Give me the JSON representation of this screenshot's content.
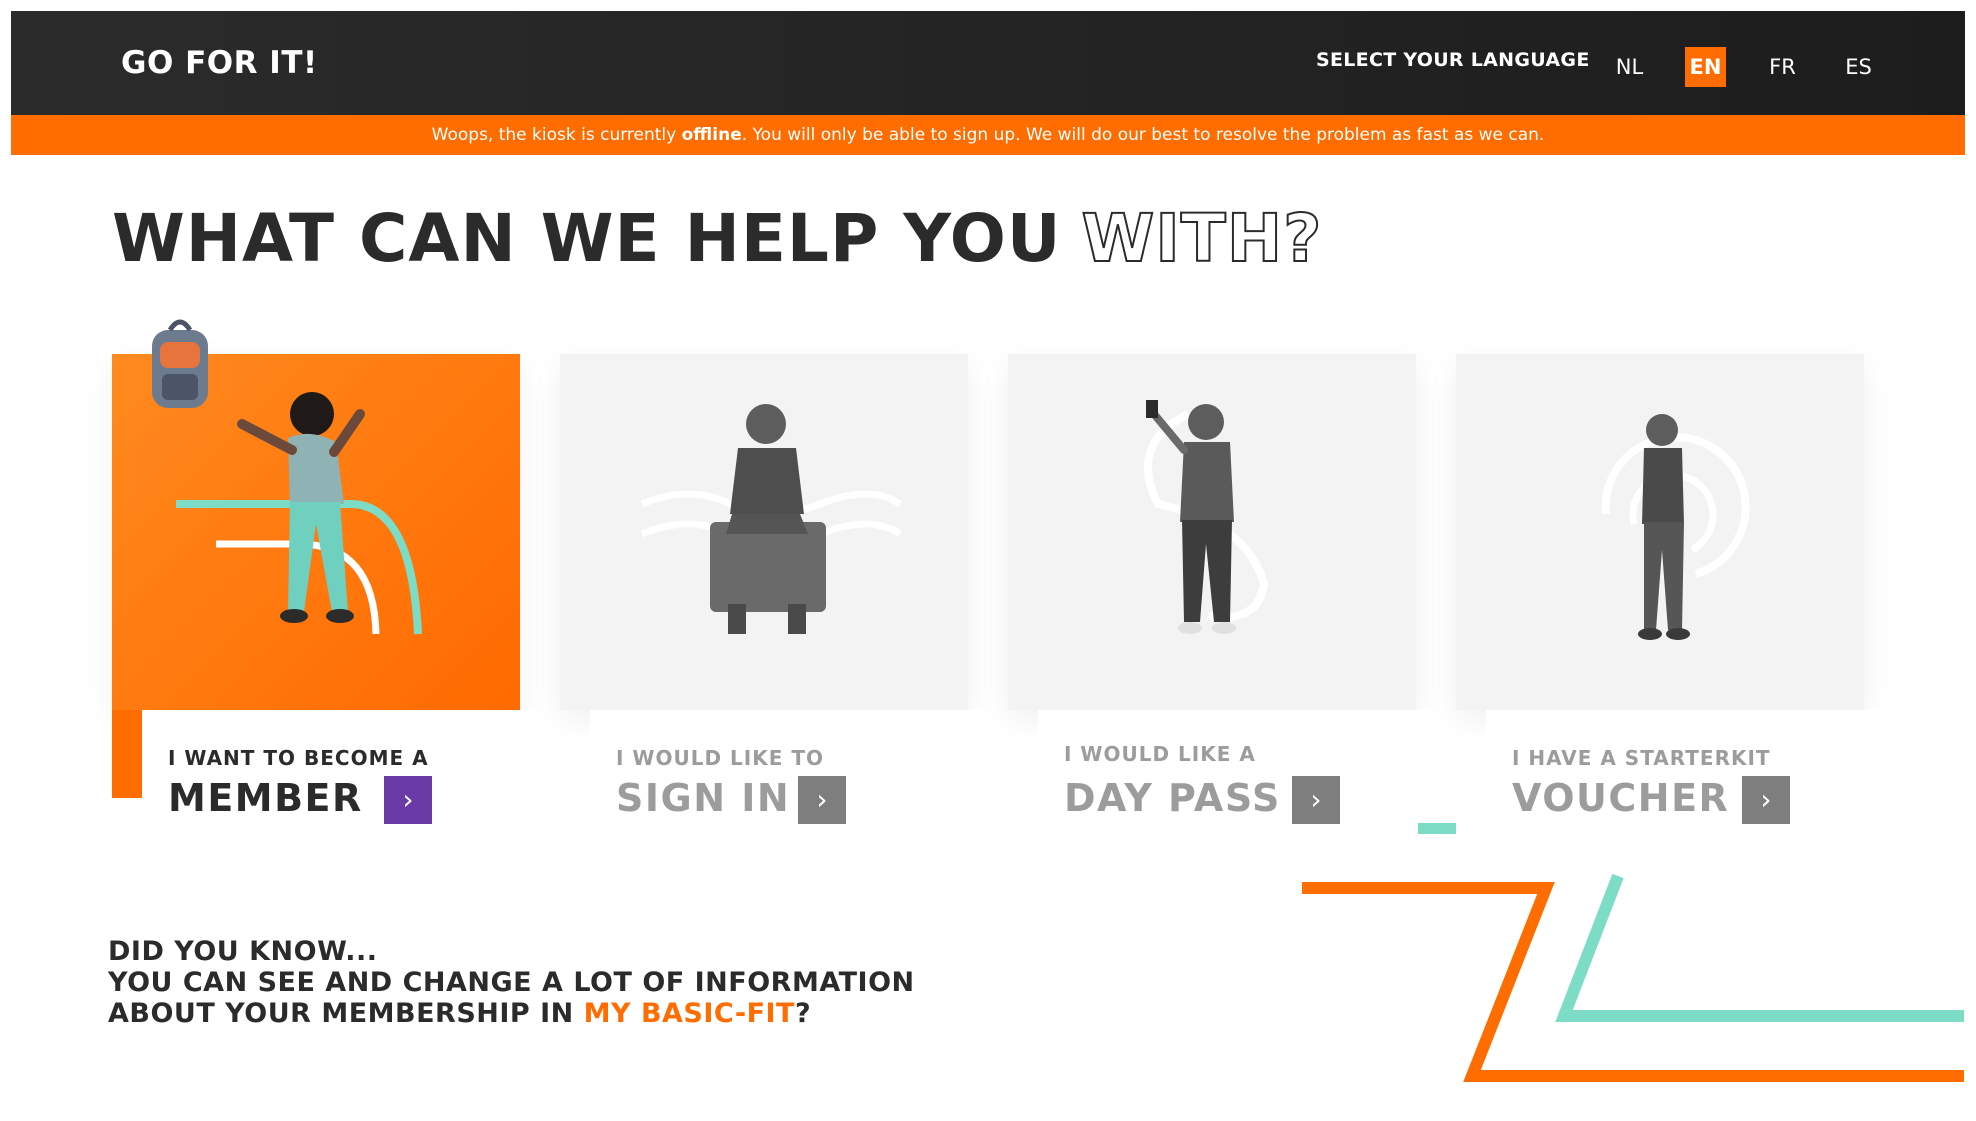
{
  "header": {
    "brand": "GO FOR IT!",
    "language_label": "SELECT YOUR LANGUAGE",
    "languages": [
      {
        "code": "NL",
        "active": false
      },
      {
        "code": "EN",
        "active": true
      },
      {
        "code": "FR",
        "active": false
      },
      {
        "code": "ES",
        "active": false
      }
    ]
  },
  "alert": {
    "prefix": "Woops, the kiosk is currently ",
    "status": "offline",
    "suffix": ". You will only be able to sign up. We will do our best to resolve the problem as fast as we can."
  },
  "headline": {
    "solid": "WHAT CAN WE HELP YOU",
    "outline": "WITH?"
  },
  "cards": [
    {
      "sub": "I WANT TO BECOME A",
      "main": "MEMBER",
      "active": true
    },
    {
      "sub": "I WOULD LIKE TO",
      "main": "SIGN IN",
      "active": false
    },
    {
      "sub": "I WOULD LIKE A",
      "main": "DAY PASS",
      "active": false
    },
    {
      "sub": "I HAVE A STARTERKIT",
      "main": "VOUCHER",
      "active": false
    }
  ],
  "did_you_know": {
    "line1": "DID YOU KNOW...",
    "line2": "YOU CAN SEE AND CHANGE A LOT OF INFORMATION",
    "line3_prefix": "ABOUT YOUR MEMBERSHIP IN ",
    "line3_link": "MY BASIC-FIT",
    "line3_suffix": "?"
  },
  "colors": {
    "brand_orange": "#ff6c00",
    "accent_purple": "#6a3aa6",
    "accent_teal": "#7ddcc6",
    "dark": "#2b2b2b"
  },
  "icons": {
    "go_button": "chevron-right-icon"
  }
}
